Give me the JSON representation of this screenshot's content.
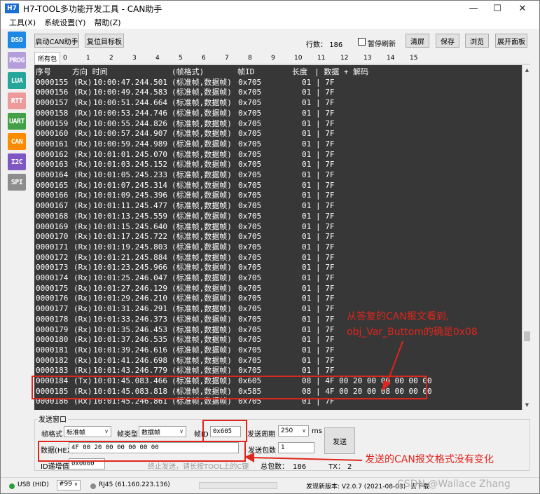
{
  "window": {
    "app_icon": "H7",
    "title": "H7-TOOL多功能开发工具 - CAN助手",
    "minimize": "—",
    "maximize": "☐",
    "close": "✕"
  },
  "menu": [
    "工具(X)",
    "系统设置(Y)",
    "帮助(Z)"
  ],
  "nav": [
    {
      "label": "DSO",
      "color": "#1e88e5"
    },
    {
      "label": "PROG",
      "color": "#b39ddb"
    },
    {
      "label": "LUA",
      "color": "#26a69a"
    },
    {
      "label": "RTT",
      "color": "#ef9a9a"
    },
    {
      "label": "UART",
      "color": "#43a047"
    },
    {
      "label": "CAN",
      "color": "#fb8c00"
    },
    {
      "label": "I2C",
      "color": "#7e57c2"
    },
    {
      "label": "SPI",
      "color": "#8d8d8d"
    }
  ],
  "toolbar": {
    "start_can": "启动CAN助手",
    "reset_target": "复位目标板",
    "lines_label": "行数：",
    "lines_value": "186",
    "pause_refresh": "暂停刷新",
    "clear": "清屏",
    "save": "保存",
    "browse": "浏览",
    "expand_panel": "展开面板"
  },
  "tabs": [
    "所有包",
    "0",
    "1",
    "2",
    "3",
    "4",
    "5",
    "6",
    "7",
    "8",
    "9",
    "10",
    "11",
    "12",
    "13",
    "14",
    "15"
  ],
  "terminal": {
    "header": {
      "seq": "序号",
      "dir_time": "方向 时间",
      "format": "(帧格式)",
      "id": "帧ID",
      "len": "长度",
      "data": "| 数据 + 解码"
    },
    "rows": [
      {
        "seq": "0000155",
        "dir": "(Rx)",
        "time": "10:00:47.244.501",
        "format": "(标准帧,数据帧)",
        "id": "0x705",
        "len": "01",
        "data": "| 7F"
      },
      {
        "seq": "0000156",
        "dir": "(Rx)",
        "time": "10:00:49.244.583",
        "format": "(标准帧,数据帧)",
        "id": "0x705",
        "len": "01",
        "data": "| 7F"
      },
      {
        "seq": "0000157",
        "dir": "(Rx)",
        "time": "10:00:51.244.664",
        "format": "(标准帧,数据帧)",
        "id": "0x705",
        "len": "01",
        "data": "| 7F"
      },
      {
        "seq": "0000158",
        "dir": "(Rx)",
        "time": "10:00:53.244.746",
        "format": "(标准帧,数据帧)",
        "id": "0x705",
        "len": "01",
        "data": "| 7F"
      },
      {
        "seq": "0000159",
        "dir": "(Rx)",
        "time": "10:00:55.244.826",
        "format": "(标准帧,数据帧)",
        "id": "0x705",
        "len": "01",
        "data": "| 7F"
      },
      {
        "seq": "0000160",
        "dir": "(Rx)",
        "time": "10:00:57.244.907",
        "format": "(标准帧,数据帧)",
        "id": "0x705",
        "len": "01",
        "data": "| 7F"
      },
      {
        "seq": "0000161",
        "dir": "(Rx)",
        "time": "10:00:59.244.989",
        "format": "(标准帧,数据帧)",
        "id": "0x705",
        "len": "01",
        "data": "| 7F"
      },
      {
        "seq": "0000162",
        "dir": "(Rx)",
        "time": "10:01:01.245.070",
        "format": "(标准帧,数据帧)",
        "id": "0x705",
        "len": "01",
        "data": "| 7F"
      },
      {
        "seq": "0000163",
        "dir": "(Rx)",
        "time": "10:01:03.245.152",
        "format": "(标准帧,数据帧)",
        "id": "0x705",
        "len": "01",
        "data": "| 7F"
      },
      {
        "seq": "0000164",
        "dir": "(Rx)",
        "time": "10:01:05.245.233",
        "format": "(标准帧,数据帧)",
        "id": "0x705",
        "len": "01",
        "data": "| 7F"
      },
      {
        "seq": "0000165",
        "dir": "(Rx)",
        "time": "10:01:07.245.314",
        "format": "(标准帧,数据帧)",
        "id": "0x705",
        "len": "01",
        "data": "| 7F"
      },
      {
        "seq": "0000166",
        "dir": "(Rx)",
        "time": "10:01:09.245.396",
        "format": "(标准帧,数据帧)",
        "id": "0x705",
        "len": "01",
        "data": "| 7F"
      },
      {
        "seq": "0000167",
        "dir": "(Rx)",
        "time": "10:01:11.245.477",
        "format": "(标准帧,数据帧)",
        "id": "0x705",
        "len": "01",
        "data": "| 7F"
      },
      {
        "seq": "0000168",
        "dir": "(Rx)",
        "time": "10:01:13.245.559",
        "format": "(标准帧,数据帧)",
        "id": "0x705",
        "len": "01",
        "data": "| 7F"
      },
      {
        "seq": "0000169",
        "dir": "(Rx)",
        "time": "10:01:15.245.640",
        "format": "(标准帧,数据帧)",
        "id": "0x705",
        "len": "01",
        "data": "| 7F"
      },
      {
        "seq": "0000170",
        "dir": "(Rx)",
        "time": "10:01:17.245.722",
        "format": "(标准帧,数据帧)",
        "id": "0x705",
        "len": "01",
        "data": "| 7F"
      },
      {
        "seq": "0000171",
        "dir": "(Rx)",
        "time": "10:01:19.245.803",
        "format": "(标准帧,数据帧)",
        "id": "0x705",
        "len": "01",
        "data": "| 7F"
      },
      {
        "seq": "0000172",
        "dir": "(Rx)",
        "time": "10:01:21.245.884",
        "format": "(标准帧,数据帧)",
        "id": "0x705",
        "len": "01",
        "data": "| 7F"
      },
      {
        "seq": "0000173",
        "dir": "(Rx)",
        "time": "10:01:23.245.966",
        "format": "(标准帧,数据帧)",
        "id": "0x705",
        "len": "01",
        "data": "| 7F"
      },
      {
        "seq": "0000174",
        "dir": "(Rx)",
        "time": "10:01:25.246.047",
        "format": "(标准帧,数据帧)",
        "id": "0x705",
        "len": "01",
        "data": "| 7F"
      },
      {
        "seq": "0000175",
        "dir": "(Rx)",
        "time": "10:01:27.246.129",
        "format": "(标准帧,数据帧)",
        "id": "0x705",
        "len": "01",
        "data": "| 7F"
      },
      {
        "seq": "0000176",
        "dir": "(Rx)",
        "time": "10:01:29.246.210",
        "format": "(标准帧,数据帧)",
        "id": "0x705",
        "len": "01",
        "data": "| 7F"
      },
      {
        "seq": "0000177",
        "dir": "(Rx)",
        "time": "10:01:31.246.291",
        "format": "(标准帧,数据帧)",
        "id": "0x705",
        "len": "01",
        "data": "| 7F"
      },
      {
        "seq": "0000178",
        "dir": "(Rx)",
        "time": "10:01:33.246.373",
        "format": "(标准帧,数据帧)",
        "id": "0x705",
        "len": "01",
        "data": "| 7F"
      },
      {
        "seq": "0000179",
        "dir": "(Rx)",
        "time": "10:01:35.246.453",
        "format": "(标准帧,数据帧)",
        "id": "0x705",
        "len": "01",
        "data": "| 7F"
      },
      {
        "seq": "0000180",
        "dir": "(Rx)",
        "time": "10:01:37.246.535",
        "format": "(标准帧,数据帧)",
        "id": "0x705",
        "len": "01",
        "data": "| 7F"
      },
      {
        "seq": "0000181",
        "dir": "(Rx)",
        "time": "10:01:39.246.616",
        "format": "(标准帧,数据帧)",
        "id": "0x705",
        "len": "01",
        "data": "| 7F"
      },
      {
        "seq": "0000182",
        "dir": "(Rx)",
        "time": "10:01:41.246.698",
        "format": "(标准帧,数据帧)",
        "id": "0x705",
        "len": "01",
        "data": "| 7F"
      },
      {
        "seq": "0000183",
        "dir": "(Rx)",
        "time": "10:01:43.246.779",
        "format": "(标准帧,数据帧)",
        "id": "0x705",
        "len": "01",
        "data": "| 7F"
      },
      {
        "seq": "0000184",
        "dir": "(Tx)",
        "time": "10:01:45.083.466",
        "format": "(标准帧,数据帧)",
        "id": "0x605",
        "len": "08",
        "data": "| 4F 00 20 00 00 00 00 00"
      },
      {
        "seq": "0000185",
        "dir": "(Rx)",
        "time": "10:01:45.083.818",
        "format": "(标准帧,数据帧)",
        "id": "0x585",
        "len": "08",
        "data": "| 4F 00 20 00 08 00 00 00"
      },
      {
        "seq": "0000186",
        "dir": "(Rx)",
        "time": "10:01:45.246.861",
        "format": "(标准帧,数据帧)",
        "id": "0x705",
        "len": "01",
        "data": "| 7F"
      }
    ]
  },
  "annotations": {
    "note_line1": "从答复的CAN报文看到,",
    "note_line2": "obj_Var_Buttom的确是0x08",
    "note_bottom": "发送的CAN报文格式没有变化",
    "color": "#e0251c"
  },
  "send": {
    "group_title": "发送窗口",
    "frame_format_label": "帧格式",
    "frame_format_value": "标准帧",
    "frame_type_label": "帧类型",
    "frame_type_value": "数据帧",
    "frame_id_label": "帧ID",
    "frame_id_value": "0x605",
    "period_label": "发送周期",
    "period_value": "250",
    "period_unit": "ms",
    "send_button": "发送",
    "data_label": "数据(HEX)",
    "data_value": "4F 00 20 00 00 00 00 00",
    "count_label": "发送包数",
    "count_value": "1",
    "id_inc_label": "ID递增值",
    "id_inc_value": "0x0000",
    "hint": "终止发送，请长按TOOL上的C键",
    "total_label": "总包数：",
    "total_value": "186",
    "tx_label": "TX：",
    "tx_value": "2"
  },
  "status": {
    "usb": "USB (HID)",
    "usb_color": "#2e9e3e",
    "device": "#99",
    "rj45": "RJ45 (61.160.223.136)",
    "rj45_color": "#8a8a8a",
    "version": "发现新版本: V2.0.7 (2021-08-03)",
    "download": "去下载",
    "watermark": "CSDN @Wallace Zhang"
  }
}
